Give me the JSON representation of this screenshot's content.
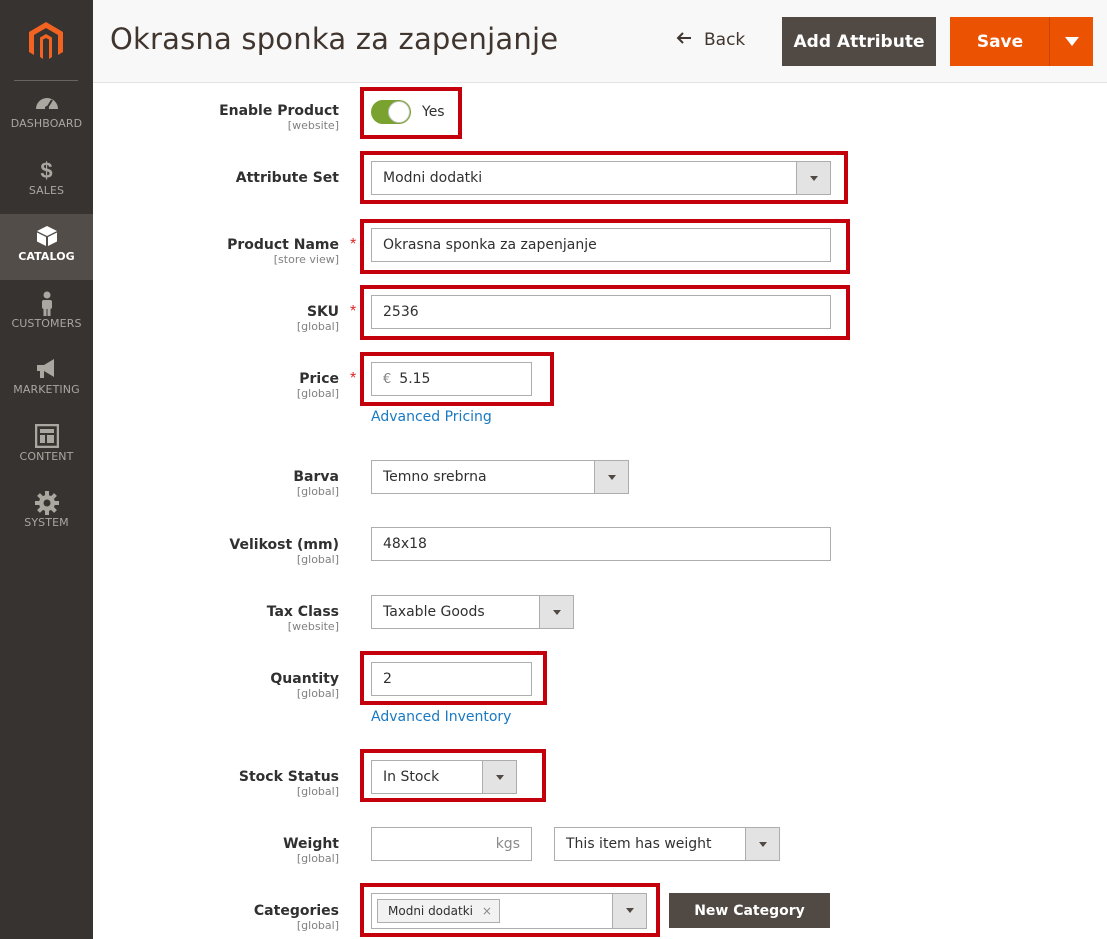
{
  "sidebar": {
    "items": [
      {
        "label": "DASHBOARD",
        "icon": "dashboard-icon"
      },
      {
        "label": "SALES",
        "icon": "dollar-icon"
      },
      {
        "label": "CATALOG",
        "icon": "box-icon"
      },
      {
        "label": "CUSTOMERS",
        "icon": "person-icon"
      },
      {
        "label": "MARKETING",
        "icon": "megaphone-icon"
      },
      {
        "label": "CONTENT",
        "icon": "layout-icon"
      },
      {
        "label": "SYSTEM",
        "icon": "gear-icon"
      }
    ],
    "active": "CATALOG"
  },
  "header": {
    "title": "Okrasna sponka za zapenjanje",
    "back_label": "Back",
    "add_attribute_label": "Add Attribute",
    "save_label": "Save"
  },
  "form": {
    "enable_product": {
      "label": "Enable Product",
      "scope": "[website]",
      "value": "Yes"
    },
    "attribute_set": {
      "label": "Attribute Set",
      "value": "Modni dodatki"
    },
    "product_name": {
      "label": "Product Name",
      "scope": "[store view]",
      "value": "Okrasna sponka za zapenjanje"
    },
    "sku": {
      "label": "SKU",
      "scope": "[global]",
      "value": "2536"
    },
    "price": {
      "label": "Price",
      "scope": "[global]",
      "currency": "€",
      "value": "5.15",
      "link": "Advanced Pricing"
    },
    "barva": {
      "label": "Barva",
      "scope": "[global]",
      "value": "Temno srebrna"
    },
    "velikost": {
      "label": "Velikost (mm)",
      "scope": "[global]",
      "value": "48x18"
    },
    "tax_class": {
      "label": "Tax Class",
      "scope": "[website]",
      "value": "Taxable Goods"
    },
    "quantity": {
      "label": "Quantity",
      "scope": "[global]",
      "value": "2",
      "link": "Advanced Inventory"
    },
    "stock_status": {
      "label": "Stock Status",
      "scope": "[global]",
      "value": "In Stock"
    },
    "weight": {
      "label": "Weight",
      "scope": "[global]",
      "value": "",
      "unit": "kgs",
      "option": "This item has weight"
    },
    "categories": {
      "label": "Categories",
      "scope": "[global]",
      "chips": [
        "Modni dodatki"
      ],
      "chip_remove": "×",
      "new_label": "New Category"
    },
    "required_mark": "*"
  },
  "colors": {
    "accent": "#eb5202",
    "highlight": "#c4000c",
    "link": "#1979c3",
    "toggle_on": "#79a22e"
  }
}
